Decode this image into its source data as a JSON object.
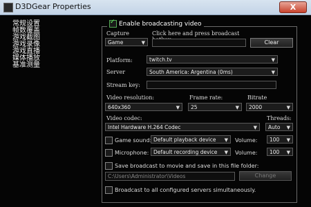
{
  "window": {
    "title": "D3DGear Properties",
    "close_label": "X"
  },
  "sidebar": {
    "items": [
      "常规设置",
      "帧数覆盖",
      "游戏截图",
      "游戏录像",
      "游戏直播",
      "媒体播放",
      "基准测量"
    ]
  },
  "broadcast": {
    "enable_label": "Enable broadcasting video",
    "capture_label": "Capture",
    "capture_value": "Game",
    "hotkey_label": "Click here and press broadcast hotkey",
    "hotkey_value": "",
    "clear_label": "Clear",
    "platform_label": "Platform:",
    "platform_value": "twitch.tv",
    "server_label": "Server",
    "server_value": "South America: Argentina    (0ms)",
    "stream_key_label": "Stream key:",
    "stream_key_value": "",
    "resolution_label": "Video resolution:",
    "resolution_value": "640x360",
    "framerate_label": "Frame rate:",
    "framerate_value": "25",
    "bitrate_label": "Bitrate",
    "bitrate_value": "2000",
    "codec_label": "Video codec:",
    "codec_value": "Intel Hardware H.264 Codec",
    "threads_label": "Threads:",
    "threads_value": "Auto",
    "game_sound_label": "Game sound:",
    "game_sound_device": "Default playback device",
    "game_volume_label": "Volume:",
    "game_volume_value": "100",
    "mic_label": "Microphone:",
    "mic_device": "Default recording device",
    "mic_volume_label": "Volume:",
    "mic_volume_value": "100",
    "save_label": "Save broadcast to movie and save in this file folder:",
    "save_path_placeholder": "C:\\Users\\Administrator\\Videos",
    "change_label": "Change",
    "all_servers_label": "Broadcast to all configured servers simultaneously."
  }
}
